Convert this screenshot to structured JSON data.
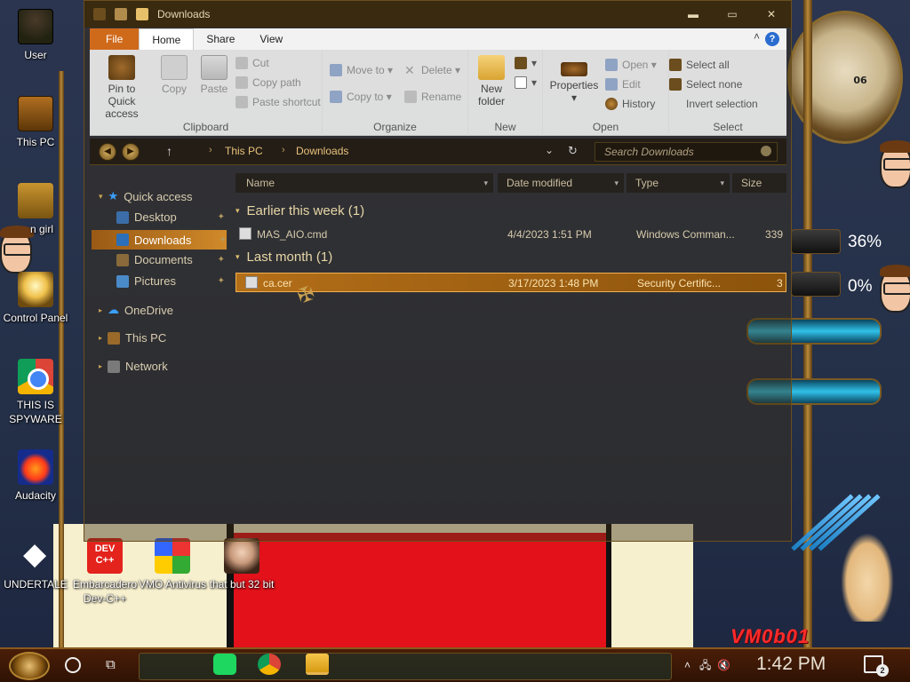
{
  "window": {
    "title": "Downloads",
    "ribbon_tabs": [
      "File",
      "Home",
      "Share",
      "View"
    ],
    "help_label": "?"
  },
  "ribbon": {
    "clipboard": {
      "label": "Clipboard",
      "pin": "Pin to Quick access",
      "copy": "Copy",
      "paste": "Paste",
      "cut": "Cut",
      "copy_path": "Copy path",
      "paste_shortcut": "Paste shortcut"
    },
    "organize": {
      "label": "Organize",
      "move_to": "Move to",
      "copy_to": "Copy to",
      "delete": "Delete",
      "rename": "Rename"
    },
    "new": {
      "label": "New",
      "new_folder": "New folder"
    },
    "open": {
      "label": "Open",
      "properties": "Properties",
      "open": "Open",
      "edit": "Edit",
      "history": "History"
    },
    "select": {
      "label": "Select",
      "select_all": "Select all",
      "select_none": "Select none",
      "invert": "Invert selection"
    }
  },
  "address": {
    "crumbs": [
      "This PC",
      "Downloads"
    ],
    "search_placeholder": "Search Downloads"
  },
  "navpane": {
    "quick_access": "Quick access",
    "items": [
      "Desktop",
      "Downloads",
      "Documents",
      "Pictures"
    ],
    "onedrive": "OneDrive",
    "this_pc": "This PC",
    "network": "Network"
  },
  "columns": [
    "Name",
    "Date modified",
    "Type",
    "Size"
  ],
  "groups": [
    {
      "title": "Earlier this week (1)",
      "files": [
        {
          "name": "MAS_AIO.cmd",
          "date": "4/4/2023 1:51 PM",
          "type": "Windows Comman...",
          "size": "339"
        }
      ]
    },
    {
      "title": "Last month (1)",
      "files": [
        {
          "name": "ca.cer",
          "date": "3/17/2023 1:48 PM",
          "type": "Security Certific...",
          "size": "3"
        }
      ]
    }
  ],
  "desktop_icons": [
    {
      "label": "User",
      "icon": "user-icon"
    },
    {
      "label": "This PC",
      "icon": "computer-icon"
    },
    {
      "label": "n girl",
      "icon": "recycle-bin-icon"
    },
    {
      "label": "Control Panel",
      "icon": "lightbulb-icon"
    },
    {
      "label": "THIS IS SPYWARE",
      "icon": "chrome-icon"
    },
    {
      "label": "Audacity",
      "icon": "audacity-icon"
    },
    {
      "label": "UNDERTALE",
      "icon": "unity-icon"
    },
    {
      "label": "Embarcadero Dev-C++",
      "icon": "devcpp-icon"
    },
    {
      "label": "VMO Antivirus",
      "icon": "shield-icon"
    },
    {
      "label": "that but 32 bit",
      "icon": "portrait-icon"
    }
  ],
  "devcpp_badge": "DEV C++",
  "widgets": {
    "clock_number": "06",
    "gauge_1": "36%",
    "gauge_2": "0%",
    "brand": "VM0b01"
  },
  "taskbar": {
    "time": "1:42 PM",
    "notification_count": "2",
    "apps": [
      "spotify",
      "chrome",
      "file-explorer"
    ]
  }
}
